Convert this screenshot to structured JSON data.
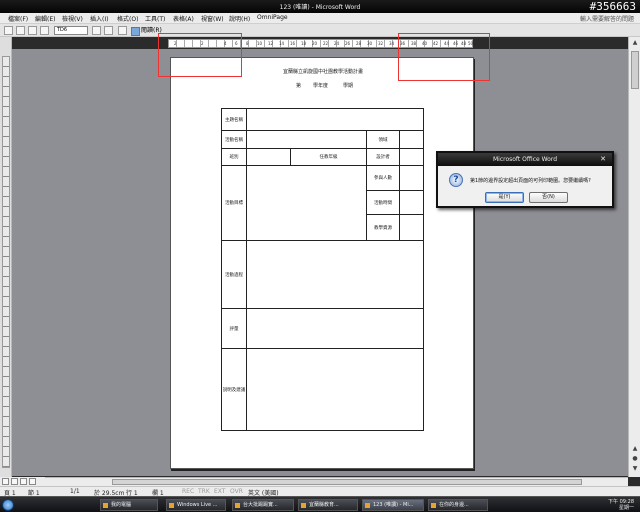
{
  "window": {
    "title": "123 (唯讀) - Microsoft Word",
    "corner_number": "#356663"
  },
  "menu": {
    "items": [
      "檔案(F)",
      "編輯(E)",
      "檢視(V)",
      "插入(I)",
      "格式(O)",
      "工具(T)",
      "表格(A)",
      "視窗(W)",
      "說明(H)",
      "OmniPage"
    ],
    "help_placeholder": "輸入需要解答的問題"
  },
  "toolbar": {
    "style_value": "TD6",
    "reading_label": "閱讀(R)"
  },
  "ruler": {
    "ticks": [
      "2",
      "2",
      "4",
      "6",
      "8",
      "10",
      "12",
      "14",
      "16",
      "18",
      "20",
      "22",
      "24",
      "26",
      "28",
      "30",
      "32",
      "34",
      "36",
      "38",
      "40",
      "42",
      "44",
      "46",
      "48",
      "50"
    ]
  },
  "document": {
    "title": "宜蘭縣立凱旋國中社團教學活動計畫",
    "subtitle_parts": [
      "第",
      "學年度",
      "學期"
    ],
    "table": {
      "topic_label": "主題名稱",
      "activity_label": "活動名稱",
      "domain_label": "領域",
      "class_label": "班別",
      "grade_label": "任教年級",
      "designer_label": "設計者",
      "objective_label": "活動目標",
      "participants_label": "參與人數",
      "time_label": "活動時間",
      "resources_label": "教學資源",
      "process_label": "活動過程",
      "evaluation_label": "評量",
      "notes_label": "說明及建議"
    }
  },
  "dialog": {
    "title": "Microsoft Office Word",
    "message": "第1節的邊界設定超出頁面的可列印範圍。您要繼續嗎?",
    "yes_label": "是(Y)",
    "no_label": "否(N)"
  },
  "status": {
    "page": "頁 1",
    "section": "節 1",
    "pages": "1/1",
    "position": "於 29.5cm",
    "line": "行 1",
    "column": "欄 1",
    "rec": "REC",
    "trk": "TRK",
    "ext": "EXT",
    "ovr": "OVR",
    "language": "英文 (美國)"
  },
  "taskbar": {
    "tasks": [
      "我的電腦",
      "Windows Live ...",
      "台大批踢踢實...",
      "宜蘭縣教育...",
      "123 (唯讀) - Mi...",
      "在你的身邊..."
    ],
    "active_task": "123 (唯讀) - Mi...",
    "time": "下午 09:28",
    "day": "星期一"
  }
}
